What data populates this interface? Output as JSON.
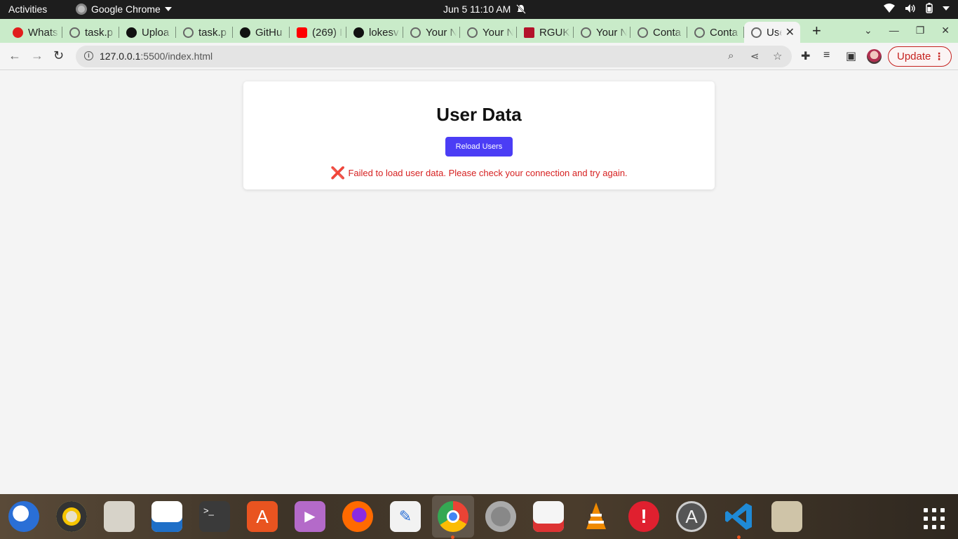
{
  "system_bar": {
    "activities": "Activities",
    "app_name": "Google Chrome",
    "datetime": "Jun 5  11:10 AM"
  },
  "tabs": [
    {
      "title": "Whats",
      "favicon_color": "#e11d1d"
    },
    {
      "title": "task.p",
      "favicon_color": "#666666"
    },
    {
      "title": "Uploa",
      "favicon_color": "#111111"
    },
    {
      "title": "task.p",
      "favicon_color": "#666666"
    },
    {
      "title": "GitHu",
      "favicon_color": "#111111"
    },
    {
      "title": "(269) I",
      "favicon_color": "#ff0000"
    },
    {
      "title": "lokesv",
      "favicon_color": "#111111"
    },
    {
      "title": "Your N",
      "favicon_color": "#666666"
    },
    {
      "title": "Your N",
      "favicon_color": "#666666"
    },
    {
      "title": "RGUK",
      "favicon_color": "#b3122a"
    },
    {
      "title": "Your N",
      "favicon_color": "#666666"
    },
    {
      "title": "Conta",
      "favicon_color": "#666666"
    },
    {
      "title": "Conta",
      "favicon_color": "#666666"
    },
    {
      "title": "User",
      "favicon_color": "#666666",
      "active": true
    }
  ],
  "address_bar": {
    "host": "127.0.0.1",
    "path": ":5500/index.html"
  },
  "update_button": "Update",
  "page": {
    "heading": "User Data",
    "reload_button": "Reload Users",
    "error_icon": "❌",
    "error_message": "Failed to load user data. Please check your connection and try again.",
    "accent_color": "#4b3df5",
    "error_color": "#d61f1f"
  },
  "dock": {
    "apps": [
      "thunderbird",
      "rhythmbox",
      "files",
      "libreoffice-writer",
      "terminal",
      "app-center",
      "videos",
      "firefox",
      "text-editor",
      "google-chrome",
      "settings",
      "document-viewer",
      "vlc",
      "update-notifier",
      "software-updater",
      "vscode",
      "archive-manager"
    ]
  }
}
